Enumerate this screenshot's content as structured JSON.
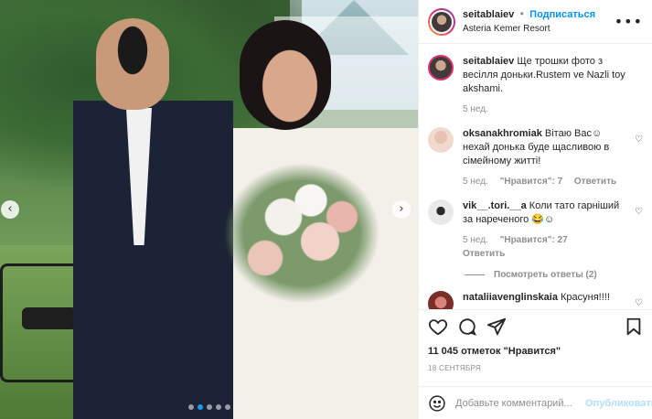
{
  "post": {
    "username": "seitablaiev",
    "separator": "•",
    "follow_label": "Подписаться",
    "location": "Asteria Kemer Resort",
    "more_label": "•••",
    "photo_alt": "",
    "slides_count": 5,
    "active_slide": 2
  },
  "caption": {
    "username": "seitablaiev",
    "text": "Ще трошки фото з весілля доньки.Rustem ve Nazli toy akshami.",
    "time": "5 нед."
  },
  "comments": [
    {
      "username": "oksanakhromiak",
      "text": "Вітаю Вас☺ нехай донька буде щасливою в сімейному житті!",
      "time": "5 нед.",
      "likes": "\"Нравится\": 7",
      "reply_label": "Ответить"
    },
    {
      "username": "vik__.tori.__a",
      "text": "Коли тато гарніший за нареченого 😂☺",
      "time": "5 нед.",
      "likes": "\"Нравится\": 27",
      "reply_label": "Ответить"
    },
    {
      "username": "nataliiavenglinskaia",
      "text": "Красуня!!!!",
      "time": "",
      "likes": "",
      "reply_label": ""
    }
  ],
  "view_replies_label": "Посмотреть ответы (2)",
  "likes_text": "11 045 отметок \"Нравится\"",
  "date_text": "18 СЕНТЯБРЯ",
  "add_comment": {
    "placeholder": "Добавьте комментарий...",
    "publish_label": "Опубликовать"
  },
  "colors": {
    "accent": "#0095f6",
    "publish_disabled": "#b2dffc",
    "muted": "#8e8e8e",
    "active_dot": "#1d9bf0"
  },
  "icons": [
    "more-options-icon",
    "heart-icon",
    "comment-icon",
    "share-icon",
    "bookmark-icon",
    "emoji-icon",
    "chevron-left-icon",
    "chevron-right-icon"
  ]
}
